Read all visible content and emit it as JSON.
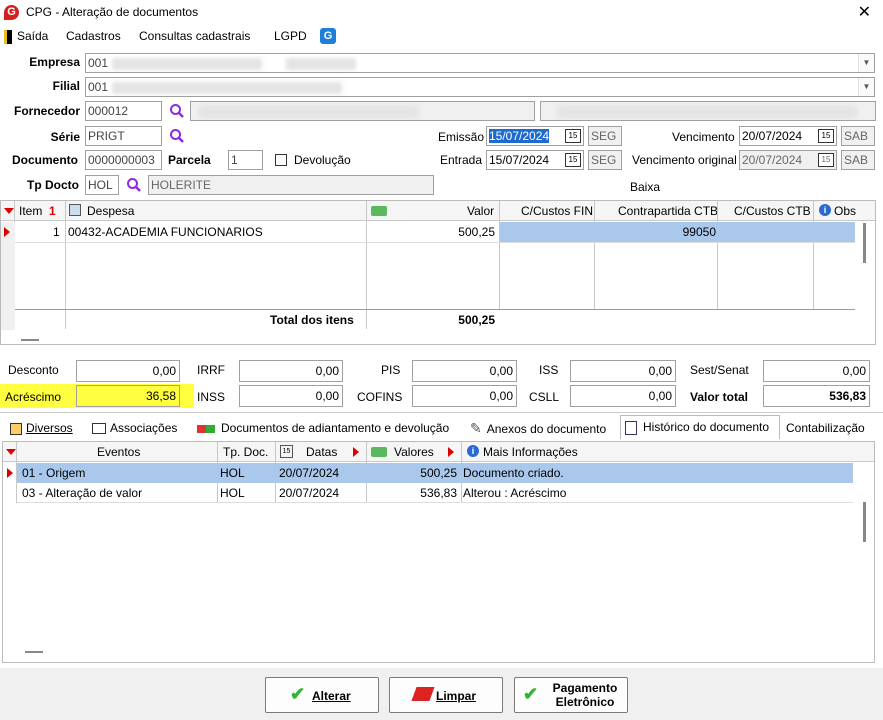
{
  "window": {
    "title": "CPG - Alteração de documentos",
    "close": "✕"
  },
  "menu": {
    "saida": "Saída",
    "cadastros": "Cadastros",
    "consultas": "Consultas cadastrais",
    "lgpd": "LGPD"
  },
  "form": {
    "empresa_label": "Empresa",
    "empresa_value": "001",
    "filial_label": "Filial",
    "filial_value": "001",
    "fornecedor_label": "Fornecedor",
    "fornecedor_value": "000012",
    "serie_label": "Série",
    "serie_value": "PRIGT",
    "documento_label": "Documento",
    "documento_value": "0000000003",
    "parcela_label": "Parcela",
    "parcela_value": "1",
    "devolucao_label": "Devolução",
    "tpdocto_label": "Tp Docto",
    "tpdocto_value": "HOL",
    "tpdocto_desc": "HOLERITE",
    "emissao_label": "Emissão",
    "emissao_value": "15/07/2024",
    "emissao_day": "SEG",
    "entrada_label": "Entrada",
    "entrada_value": "15/07/2024",
    "entrada_day": "SEG",
    "vencimento_label": "Vencimento",
    "vencimento_value": "20/07/2024",
    "vencimento_day": "SAB",
    "venc_original_label": "Vencimento original",
    "venc_original_value": "20/07/2024",
    "venc_original_day": "SAB",
    "baixa_label": "Baixa"
  },
  "items_grid": {
    "headers": {
      "item": "Item",
      "sort": "1",
      "despesa": "Despesa",
      "valor": "Valor",
      "ccfin": "C/Custos FIN",
      "contrapartida": "Contrapartida CTB",
      "ccctb": "C/Custos CTB",
      "obs": "Obs"
    },
    "rows": [
      {
        "item": "1",
        "despesa": "00432-ACADEMIA FUNCIONARIOS",
        "valor": "500,25",
        "contrapartida": "99050"
      }
    ],
    "total_label": "Total dos itens",
    "total_value": "500,25"
  },
  "totals": {
    "desconto_label": "Desconto",
    "desconto": "0,00",
    "acrescimo_label": "Acréscimo",
    "acrescimo": "36,58",
    "irrf_label": "IRRF",
    "irrf": "0,00",
    "inss_label": "INSS",
    "inss": "0,00",
    "pis_label": "PIS",
    "pis": "0,00",
    "cofins_label": "COFINS",
    "cofins": "0,00",
    "iss_label": "ISS",
    "iss": "0,00",
    "csll_label": "CSLL",
    "csll": "0,00",
    "sest_label": "Sest/Senat",
    "sest": "0,00",
    "valor_total_label": "Valor total",
    "valor_total": "536,83"
  },
  "tabs": [
    "Diversos",
    "Associações",
    "Documentos de adiantamento e devolução",
    "Anexos do documento",
    "Histórico do documento",
    "Contabilização"
  ],
  "history_grid": {
    "headers": {
      "eventos": "Eventos",
      "tpdoc": "Tp. Doc.",
      "datas": "Datas",
      "valores": "Valores",
      "info": "Mais Informações"
    },
    "rows": [
      {
        "evento": "01 - Origem",
        "tpdoc": "HOL",
        "data": "20/07/2024",
        "valor": "500,25",
        "info": "Documento criado."
      },
      {
        "evento": "03 - Alteração de valor",
        "tpdoc": "HOL",
        "data": "20/07/2024",
        "valor": "536,83",
        "info": "Alterou : Acréscimo"
      }
    ]
  },
  "buttons": {
    "alterar": "Alterar",
    "limpar": "Limpar",
    "pagamento": "Pagamento",
    "eletronico": "Eletrônico"
  },
  "colors": {
    "selection": "#a9c8ec",
    "highlight": "#ffff40",
    "accent_red": "#d42020"
  }
}
